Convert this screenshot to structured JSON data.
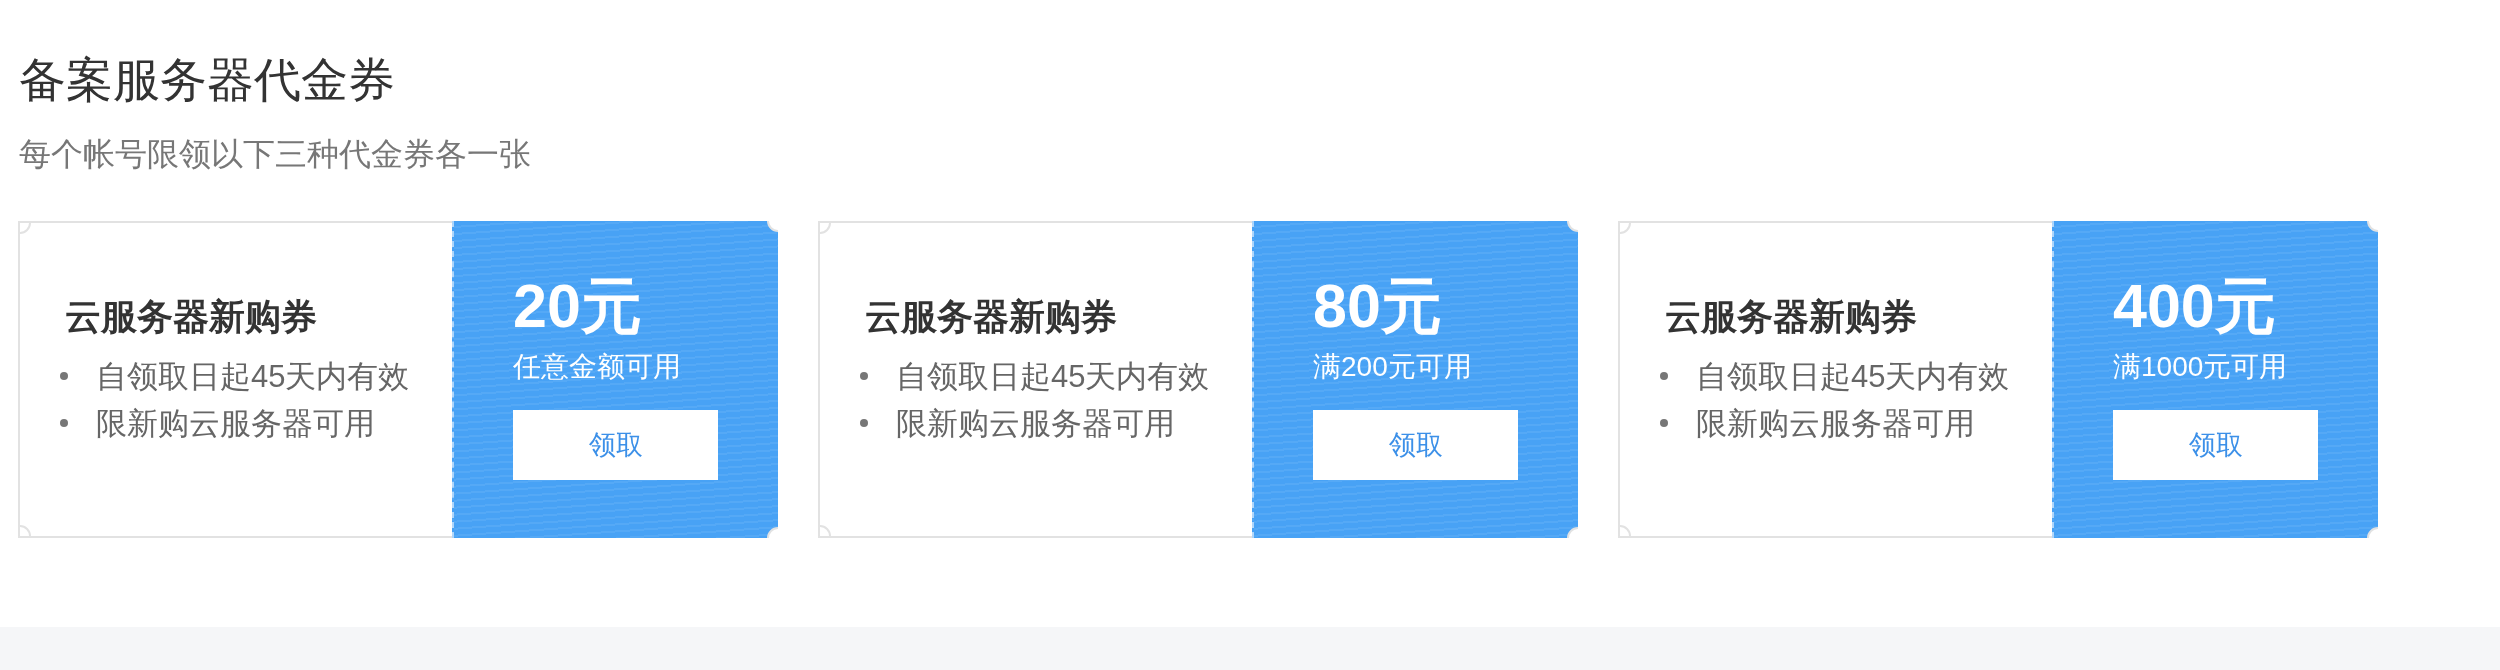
{
  "title": "备案服务器代金券",
  "subtitle": "每个帐号限领以下三种代金券各一张",
  "coupons": [
    {
      "name": "云服务器新购券",
      "terms": [
        "自领取日起45天内有效",
        "限新购云服务器可用"
      ],
      "amount": "20元",
      "condition": "任意金额可用",
      "button": "领取"
    },
    {
      "name": "云服务器新购券",
      "terms": [
        "自领取日起45天内有效",
        "限新购云服务器可用"
      ],
      "amount": "80元",
      "condition": "满200元可用",
      "button": "领取"
    },
    {
      "name": "云服务器新购券",
      "terms": [
        "自领取日起45天内有效",
        "限新购云服务器可用"
      ],
      "amount": "400元",
      "condition": "满1000元可用",
      "button": "领取"
    }
  ]
}
